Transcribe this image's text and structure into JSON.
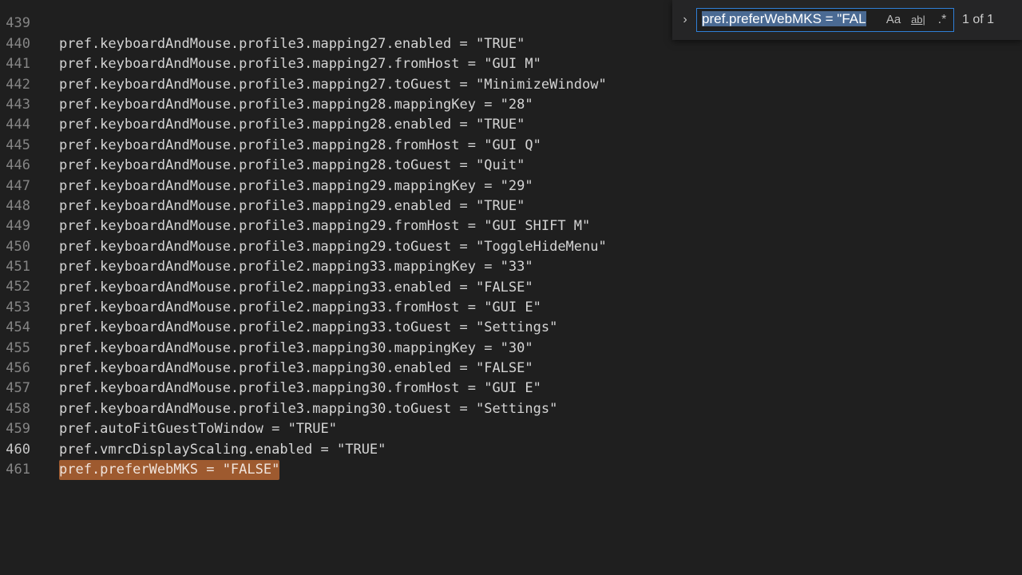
{
  "editor": {
    "lines": [
      {
        "num": "439",
        "text": "pref.keyboardAndMouse.profile3.mapping27.enabled = \"TRUE\""
      },
      {
        "num": "440",
        "text": "pref.keyboardAndMouse.profile3.mapping27.fromHost = \"GUI M\""
      },
      {
        "num": "441",
        "text": "pref.keyboardAndMouse.profile3.mapping27.toGuest = \"MinimizeWindow\""
      },
      {
        "num": "442",
        "text": "pref.keyboardAndMouse.profile3.mapping28.mappingKey = \"28\""
      },
      {
        "num": "443",
        "text": "pref.keyboardAndMouse.profile3.mapping28.enabled = \"TRUE\""
      },
      {
        "num": "444",
        "text": "pref.keyboardAndMouse.profile3.mapping28.fromHost = \"GUI Q\""
      },
      {
        "num": "445",
        "text": "pref.keyboardAndMouse.profile3.mapping28.toGuest = \"Quit\""
      },
      {
        "num": "446",
        "text": "pref.keyboardAndMouse.profile3.mapping29.mappingKey = \"29\""
      },
      {
        "num": "447",
        "text": "pref.keyboardAndMouse.profile3.mapping29.enabled = \"TRUE\""
      },
      {
        "num": "448",
        "text": "pref.keyboardAndMouse.profile3.mapping29.fromHost = \"GUI SHIFT M\""
      },
      {
        "num": "449",
        "text": "pref.keyboardAndMouse.profile3.mapping29.toGuest = \"ToggleHideMenu\""
      },
      {
        "num": "450",
        "text": "pref.keyboardAndMouse.profile2.mapping33.mappingKey = \"33\""
      },
      {
        "num": "451",
        "text": "pref.keyboardAndMouse.profile2.mapping33.enabled = \"FALSE\""
      },
      {
        "num": "452",
        "text": "pref.keyboardAndMouse.profile2.mapping33.fromHost = \"GUI E\""
      },
      {
        "num": "453",
        "text": "pref.keyboardAndMouse.profile2.mapping33.toGuest = \"Settings\""
      },
      {
        "num": "454",
        "text": "pref.keyboardAndMouse.profile3.mapping30.mappingKey = \"30\""
      },
      {
        "num": "455",
        "text": "pref.keyboardAndMouse.profile3.mapping30.enabled = \"FALSE\""
      },
      {
        "num": "456",
        "text": "pref.keyboardAndMouse.profile3.mapping30.fromHost = \"GUI E\""
      },
      {
        "num": "457",
        "text": "pref.keyboardAndMouse.profile3.mapping30.toGuest = \"Settings\""
      },
      {
        "num": "458",
        "text": "pref.autoFitGuestToWindow = \"TRUE\""
      },
      {
        "num": "459",
        "text": "pref.vmrcDisplayScaling.enabled = \"TRUE\""
      },
      {
        "num": "460",
        "text": "pref.preferWebMKS = \"FALSE\""
      },
      {
        "num": "461",
        "text": ""
      }
    ]
  },
  "find": {
    "toggle_icon": "›",
    "query": "pref.preferWebMKS = \"FAL",
    "match_case_label": "Aa",
    "whole_word_label": "ab|",
    "regex_label": ".*",
    "match_count": "1 of 1"
  },
  "icons": {
    "toggle_replace": "chevron-right-icon"
  },
  "colors": {
    "background": "#1f1f1f",
    "match_highlight": "#9e5a2f",
    "find_border": "#2f7fd6"
  }
}
